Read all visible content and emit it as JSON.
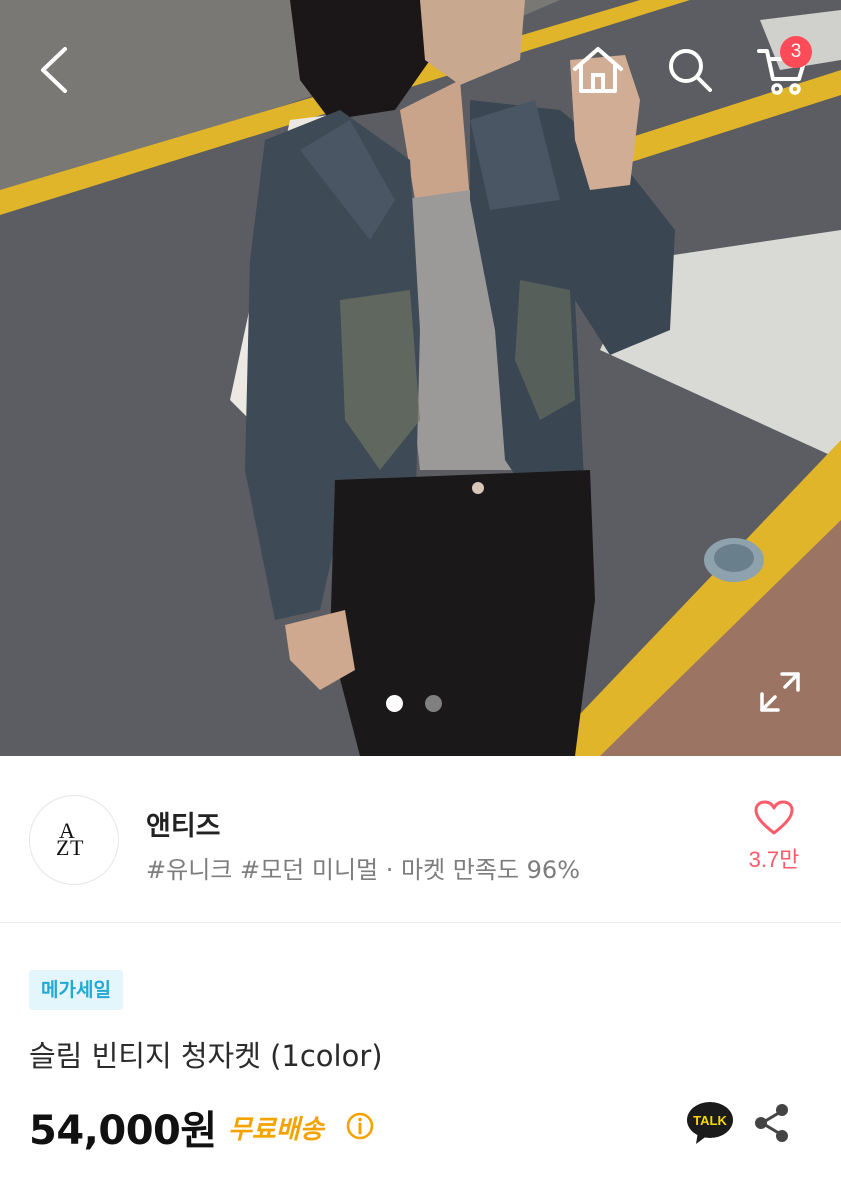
{
  "nav": {
    "back_icon": "chevron-left-icon",
    "home_icon": "home-icon",
    "search_icon": "search-icon",
    "cart_icon": "cart-icon",
    "cart_count": "3"
  },
  "gallery": {
    "image_count": 2,
    "active_index": 0,
    "expand_icon": "expand-icon"
  },
  "store": {
    "name": "앤티즈",
    "logo_text": [
      "A",
      "Z",
      "T"
    ],
    "tags": "#유니크 #모던 미니멀 · 마켓 만족도 96%",
    "like_count": "3.7만"
  },
  "product": {
    "badge": "메가세일",
    "title": "슬림 빈티지 청자켓 (1color)",
    "price": "54,000원",
    "shipping": "무료배송",
    "kakao_label": "TALK"
  },
  "colors": {
    "badge_text": "#23a8d4",
    "badge_bg": "#e2f6fb",
    "shipping": "#f5a300",
    "like": "#ff5a6a",
    "cart_badge": "#ff4a57"
  }
}
